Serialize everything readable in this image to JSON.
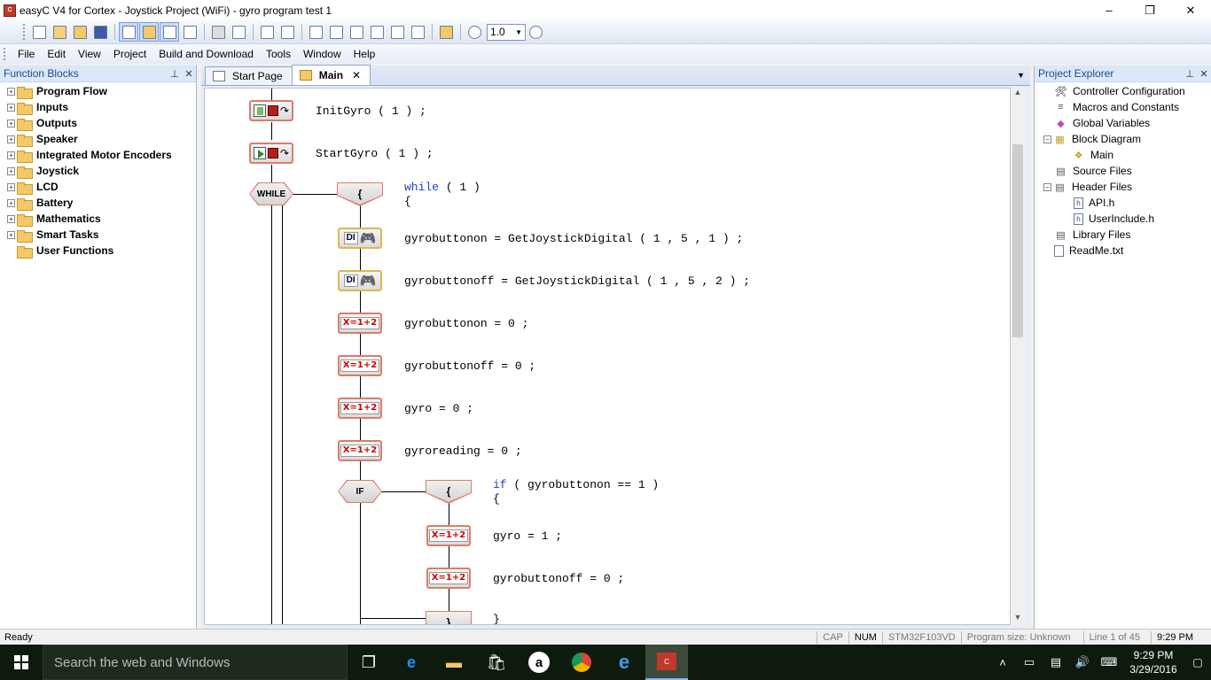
{
  "window": {
    "title": "easyC V4 for Cortex - Joystick Project (WiFi) - gyro program test 1",
    "controls": [
      "–",
      "❐",
      "✕"
    ]
  },
  "toolbar": {
    "zoom": "1.0"
  },
  "menu": [
    "File",
    "Edit",
    "View",
    "Project",
    "Build and Download",
    "Tools",
    "Window",
    "Help"
  ],
  "function_blocks": {
    "title": "Function Blocks",
    "items": [
      "Program Flow",
      "Inputs",
      "Outputs",
      "Speaker",
      "Integrated Motor Encoders",
      "Joystick",
      "LCD",
      "Battery",
      "Mathematics",
      "Smart Tasks",
      "User Functions"
    ]
  },
  "tabs": [
    {
      "label": "Start Page"
    },
    {
      "label": "Main"
    }
  ],
  "tab_close": "✕",
  "flow": {
    "init_gyro": "InitGyro ( 1 ) ;",
    "start_gyro": "StartGyro ( 1 ) ;",
    "while_label": "WHILE",
    "while_kw": "while",
    "while_rest": " ( 1 )",
    "open_brace": "{",
    "close_brace": "}",
    "btn_on": "gyrobuttonon = GetJoystickDigital ( 1 , 5 , 1 ) ;",
    "btn_off": "gyrobuttonoff = GetJoystickDigital ( 1 , 5 , 2 ) ;",
    "set_on_zero": "gyrobuttonon = 0 ;",
    "set_off_zero": "gyrobuttonoff = 0 ;",
    "gyro_zero": "gyro = 0 ;",
    "reading_zero": "gyroreading = 0 ;",
    "if_label": "IF",
    "if_kw": "if",
    "if_rest": " ( gyrobuttonon == 1 )",
    "gyro_one": "gyro = 1 ;",
    "off_zero2": "gyrobuttonoff = 0 ;",
    "expr_label": "X=1+2",
    "di_label": "DI"
  },
  "project_explorer": {
    "title": "Project Explorer",
    "items": [
      {
        "label": "Controller Configuration"
      },
      {
        "label": "Macros and Constants"
      },
      {
        "label": "Global Variables"
      },
      {
        "label": "Block Diagram"
      },
      {
        "label": "Main"
      },
      {
        "label": "Source Files"
      },
      {
        "label": "Header Files"
      },
      {
        "label": "API.h"
      },
      {
        "label": "UserInclude.h"
      },
      {
        "label": "Library Files"
      },
      {
        "label": "ReadMe.txt"
      }
    ]
  },
  "status": {
    "ready": "Ready",
    "cap": "CAP",
    "num": "NUM",
    "device": "STM32F103VD",
    "program_size": "Program size: Unknown",
    "line": "Line   1  of   45",
    "time": "9:29 PM"
  },
  "taskbar": {
    "search_placeholder": "Search the web and Windows",
    "clock_time": "9:29 PM",
    "clock_date": "3/29/2016"
  }
}
